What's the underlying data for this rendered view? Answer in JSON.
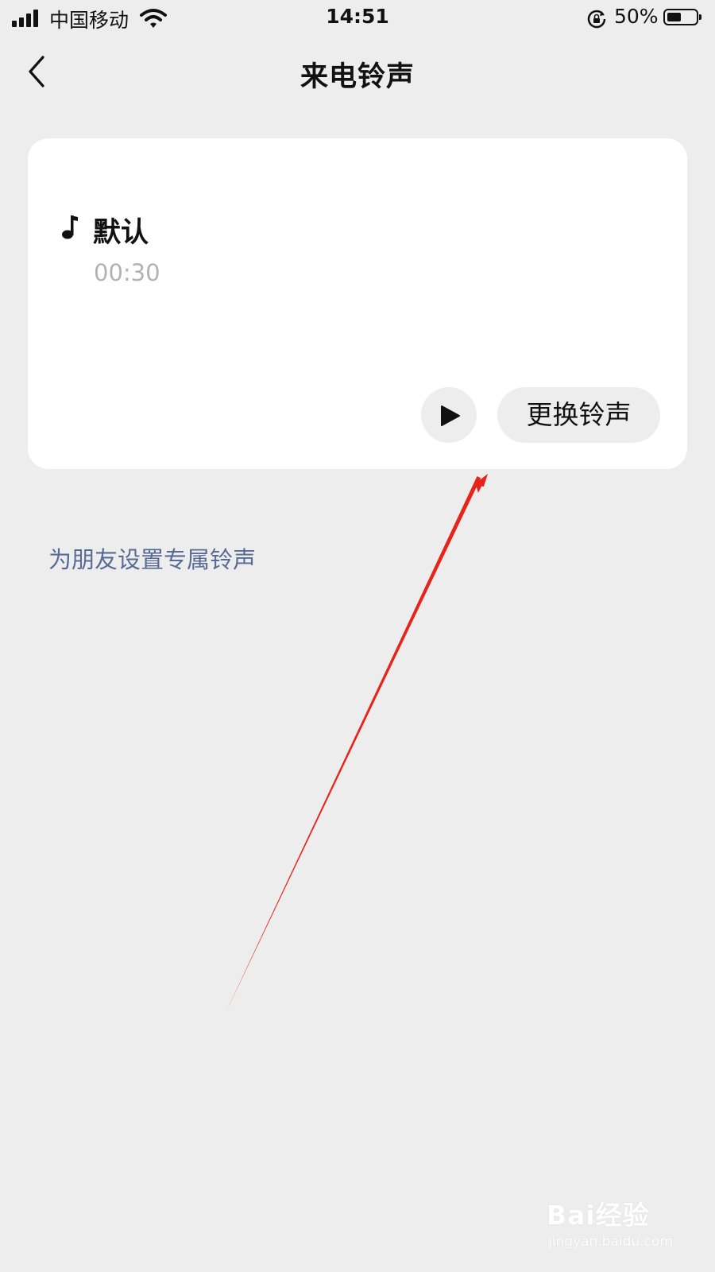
{
  "status_bar": {
    "carrier": "中国移动",
    "time": "14:51",
    "battery_percent": "50%",
    "battery_level": 0.5
  },
  "nav": {
    "title": "来电铃声",
    "back_icon": "chevron-left-icon"
  },
  "ringtone_card": {
    "icon": "music-note-icon",
    "name": "默认",
    "duration": "00:30",
    "play_icon": "play-icon",
    "change_label": "更换铃声"
  },
  "friend_link": "为朋友设置专属铃声",
  "colors": {
    "background": "#ededed",
    "card": "#ffffff",
    "link": "#576b95",
    "muted_text": "#b2b2b2",
    "annotation_arrow": "#e8231a"
  },
  "watermark": {
    "brand": "Bai经验",
    "url": "jingyan.baidu.com"
  }
}
